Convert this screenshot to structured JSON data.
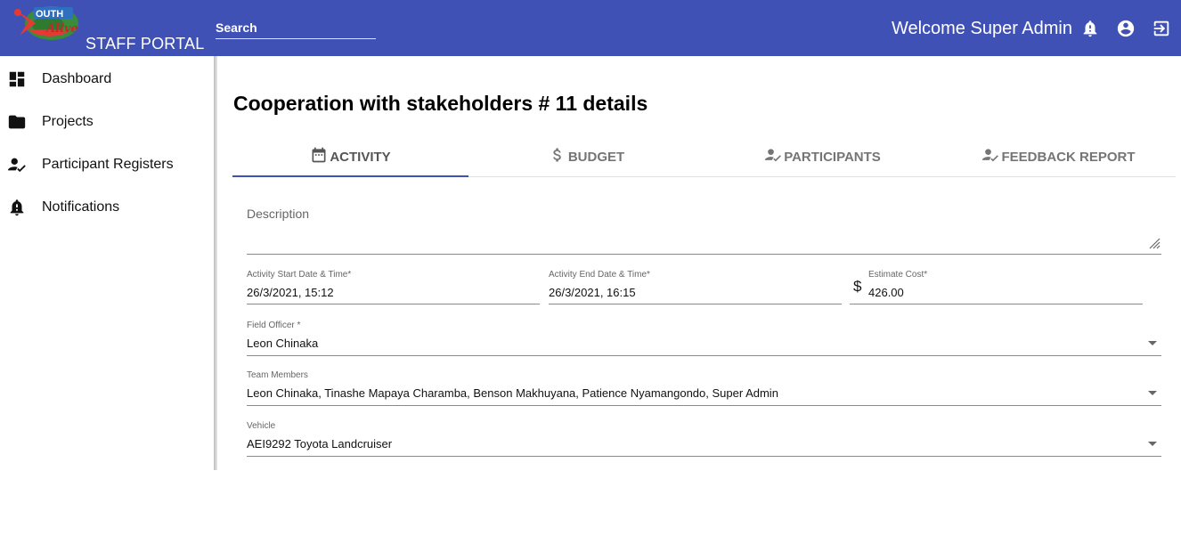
{
  "header": {
    "logo_text": "Youth Alive Zimbabwe",
    "portal_title": "STAFF PORTAL",
    "search_placeholder": "Search",
    "welcome": "Welcome Super Admin",
    "icons": [
      "bell-icon",
      "account-circle-icon",
      "logout-icon"
    ],
    "bar_color": "#3f51b5"
  },
  "sidebar": {
    "items": [
      {
        "label": "Dashboard",
        "icon": "dashboard-icon"
      },
      {
        "label": "Projects",
        "icon": "folder-icon"
      },
      {
        "label": "Participant Registers",
        "icon": "person-check-icon"
      },
      {
        "label": "Notifications",
        "icon": "bell-icon"
      }
    ]
  },
  "main": {
    "title": "Cooperation with stakeholders # 11 details",
    "tabs": [
      {
        "label": "ACTIVITY",
        "icon": "calendar-icon",
        "active": true
      },
      {
        "label": "BUDGET",
        "icon": "dollar-icon",
        "active": false
      },
      {
        "label": "PARTICIPANTS",
        "icon": "person-check-icon",
        "active": false
      },
      {
        "label": "FEEDBACK REPORT",
        "icon": "person-check-icon",
        "active": false
      }
    ],
    "form": {
      "description": {
        "label": "Description",
        "value": ""
      },
      "start": {
        "label": "Activity Start Date & Time*",
        "value": "26/3/2021, 15:12"
      },
      "end": {
        "label": "Activity End Date & Time*",
        "value": "26/3/2021, 16:15"
      },
      "cost": {
        "label": "Estimate Cost*",
        "prefix": "$",
        "value": "426.00"
      },
      "field_officer": {
        "label": "Field Officer *",
        "value": "Leon Chinaka"
      },
      "team_members": {
        "label": "Team Members",
        "value": "Leon Chinaka, Tinashe Mapaya Charamba, Benson Makhuyana, Patience Nyamangondo, Super Admin"
      },
      "vehicle": {
        "label": "Vehicle",
        "value": "AEI9292 Toyota Landcruiser"
      }
    }
  }
}
